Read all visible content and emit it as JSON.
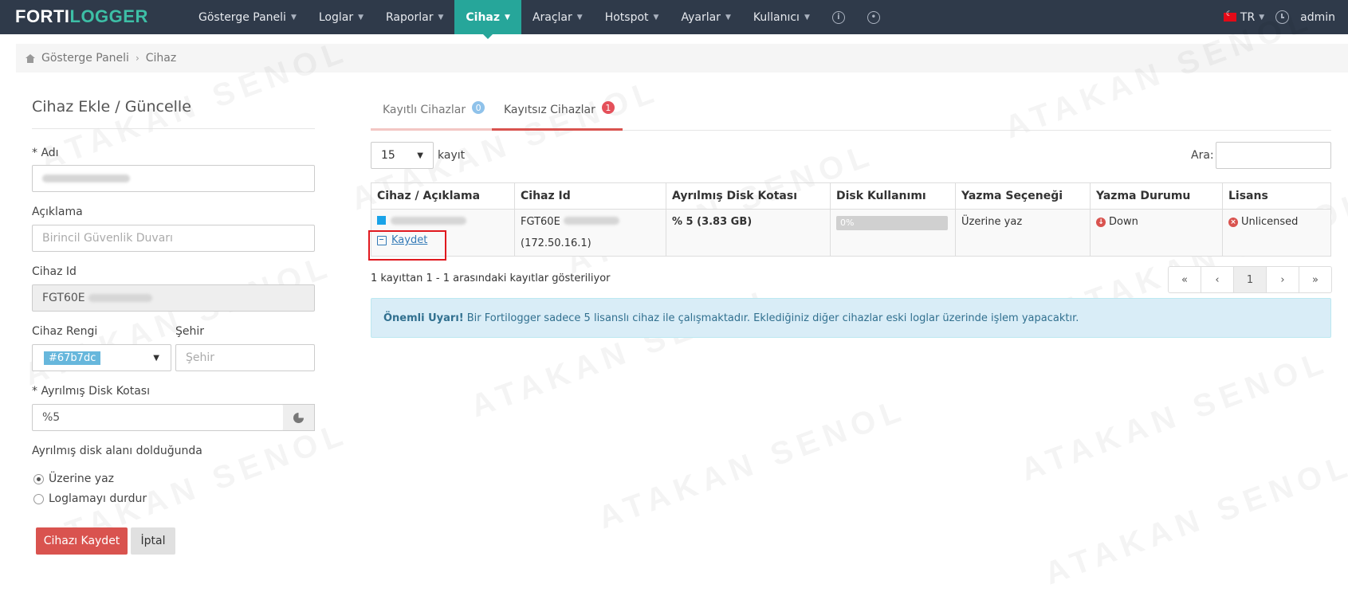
{
  "brand": {
    "part1": "FORTI",
    "part2": "LOGGER"
  },
  "nav": [
    {
      "label": "Gösterge Paneli",
      "active": false
    },
    {
      "label": "Loglar",
      "active": false
    },
    {
      "label": "Raporlar",
      "active": false
    },
    {
      "label": "Cihaz",
      "active": true
    },
    {
      "label": "Araçlar",
      "active": false
    },
    {
      "label": "Hotspot",
      "active": false
    },
    {
      "label": "Ayarlar",
      "active": false
    },
    {
      "label": "Kullanıcı",
      "active": false
    }
  ],
  "nav_right": {
    "language": "TR",
    "user": "admin"
  },
  "breadcrumb": {
    "home": "Gösterge Paneli",
    "current": "Cihaz"
  },
  "form": {
    "title": "Cihaz Ekle / Güncelle",
    "name_label": "* Adı",
    "description_label": "Açıklama",
    "description_placeholder": "Birincil Güvenlik Duvarı",
    "device_id_label": "Cihaz Id",
    "device_id_value": "FGT60E",
    "color_label": "Cihaz Rengi",
    "color_value": "#67b7dc",
    "city_label": "Şehir",
    "city_placeholder": "Şehir",
    "quota_label": "* Ayrılmış Disk Kotası",
    "quota_value": "%5",
    "full_label": "Ayrılmış disk alanı dolduğunda",
    "radio_overwrite": "Üzerine yaz",
    "radio_stop": "Loglamayı durdur",
    "save_button": "Cihazı Kaydet",
    "cancel_button": "İptal"
  },
  "tabs": [
    {
      "label": "Kayıtlı Cihazlar",
      "count": "0"
    },
    {
      "label": "Kayıtsız Cihazlar",
      "count": "1"
    }
  ],
  "table_controls": {
    "length_value": "15",
    "length_label": "kayıt",
    "search_label": "Ara:"
  },
  "table": {
    "columns": [
      "Cihaz / Açıklama",
      "Cihaz Id",
      "Ayrılmış Disk Kotası",
      "Disk Kullanımı",
      "Yazma Seçeneği",
      "Yazma Durumu",
      "Lisans"
    ],
    "row": {
      "color": "#1aa3e8",
      "save_link": "Kaydet",
      "device_id": "FGT60E",
      "ip": "(172.50.16.1)",
      "quota": "% 5 (3.83 GB)",
      "usage_text": "0%",
      "usage_percent": 0,
      "write_option": "Üzerine yaz",
      "write_status": "Down",
      "license": "Unlicensed"
    }
  },
  "info_text": "1 kayıttan 1 - 1 arasındaki kayıtlar gösteriliyor",
  "pagination": {
    "first": "«",
    "prev": "‹",
    "current": "1",
    "next": "›",
    "last": "»"
  },
  "alert": {
    "strong": "Önemli Uyarı!",
    "text": "Bir Fortilogger sadece 5 lisanslı cihaz ile çalışmaktadır. Eklediğiniz diğer cihazlar eski loglar üzerinde işlem yapacaktır."
  },
  "watermark": "ATAKAN SENOL"
}
